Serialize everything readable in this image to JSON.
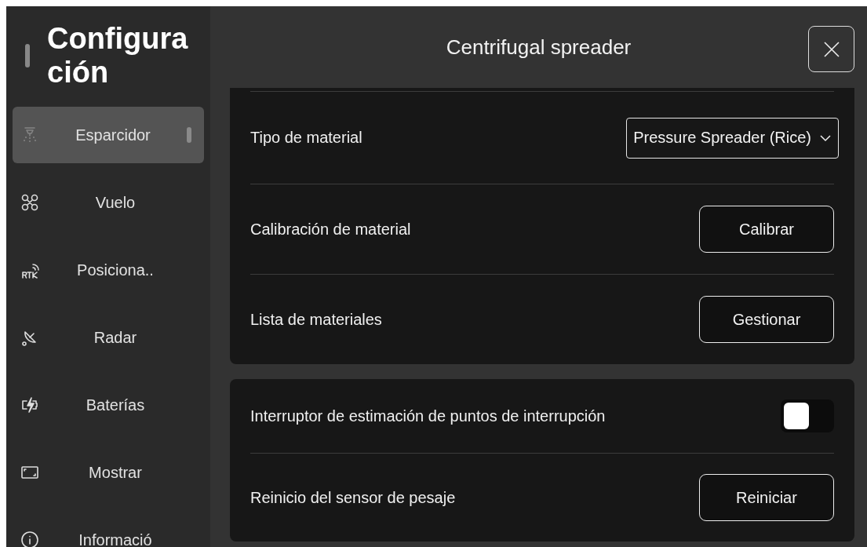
{
  "sidebar": {
    "title": "Configura\nción",
    "items": [
      {
        "label": "Esparcidor",
        "selected": true
      },
      {
        "label": "Vuelo",
        "selected": false
      },
      {
        "label": "Posiciona..",
        "selected": false
      },
      {
        "label": "Radar",
        "selected": false
      },
      {
        "label": "Baterías",
        "selected": false
      },
      {
        "label": "Mostrar",
        "selected": false
      },
      {
        "label": "Informació",
        "selected": false
      }
    ]
  },
  "header": {
    "title": "Centrifugal spreader"
  },
  "cards": [
    {
      "rows": [
        {
          "kind": "dropdown",
          "label": "Tipo de material",
          "value": "Pressure Spreader (Rice)"
        },
        {
          "kind": "button",
          "label": "Calibración de material",
          "action": "Calibrar"
        },
        {
          "kind": "button",
          "label": "Lista de materiales",
          "action": "Gestionar"
        }
      ]
    },
    {
      "rows": [
        {
          "kind": "toggle",
          "label": "Interruptor de estimación de puntos de interrupción",
          "on": false
        },
        {
          "kind": "button",
          "label": "Reinicio del sensor de pesaje",
          "action": "Reiniciar"
        }
      ]
    }
  ]
}
